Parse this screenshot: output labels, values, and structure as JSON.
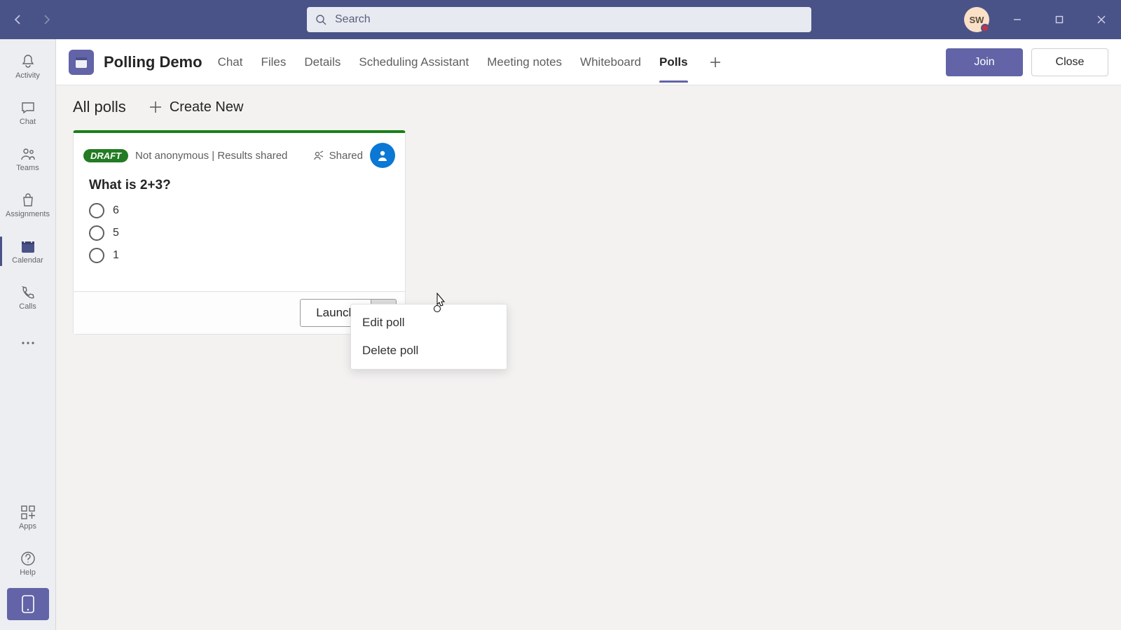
{
  "titlebar": {
    "search_placeholder": "Search",
    "avatar_initials": "SW"
  },
  "apprail": {
    "items": [
      {
        "label": "Activity"
      },
      {
        "label": "Chat"
      },
      {
        "label": "Teams"
      },
      {
        "label": "Assignments"
      },
      {
        "label": "Calendar"
      },
      {
        "label": "Calls"
      }
    ],
    "bottom": [
      {
        "label": "Apps"
      },
      {
        "label": "Help"
      }
    ]
  },
  "tabbar": {
    "meeting_title": "Polling Demo",
    "tabs": [
      {
        "label": "Chat"
      },
      {
        "label": "Files"
      },
      {
        "label": "Details"
      },
      {
        "label": "Scheduling Assistant"
      },
      {
        "label": "Meeting notes"
      },
      {
        "label": "Whiteboard"
      },
      {
        "label": "Polls"
      }
    ],
    "join_label": "Join",
    "close_label": "Close"
  },
  "page": {
    "title": "All polls",
    "create_label": "Create New"
  },
  "poll": {
    "badge": "DRAFT",
    "meta": "Not anonymous | Results shared",
    "shared_label": "Shared",
    "question": "What is 2+3?",
    "options": [
      "6",
      "5",
      "1"
    ],
    "launch_label": "Launch"
  },
  "dropdown": {
    "items": [
      "Edit poll",
      "Delete poll"
    ]
  }
}
